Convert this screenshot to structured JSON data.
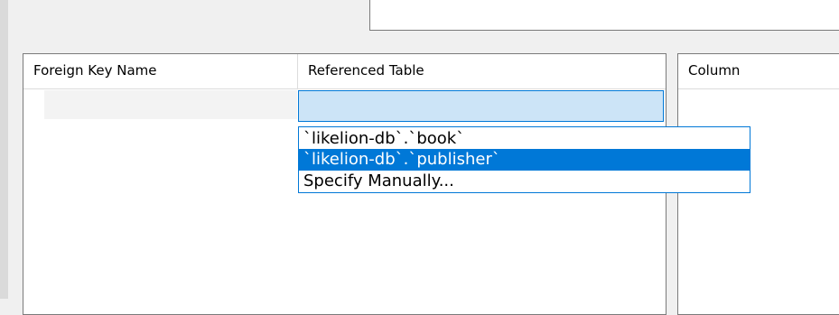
{
  "fk_grid": {
    "columns": [
      "Foreign Key Name",
      "Referenced Table"
    ],
    "rows": [
      {
        "name": "",
        "referenced_table": ""
      }
    ]
  },
  "referenced_table_dropdown": {
    "options": [
      "`likelion-db`.`book`",
      "`likelion-db`.`publisher`",
      "Specify Manually..."
    ],
    "highlighted_option": "`likelion-db`.`publisher`"
  },
  "column_grid": {
    "columns": [
      "Column"
    ]
  },
  "colors": {
    "selection": "#0078d7",
    "edit_cell": "#cce4f7"
  }
}
